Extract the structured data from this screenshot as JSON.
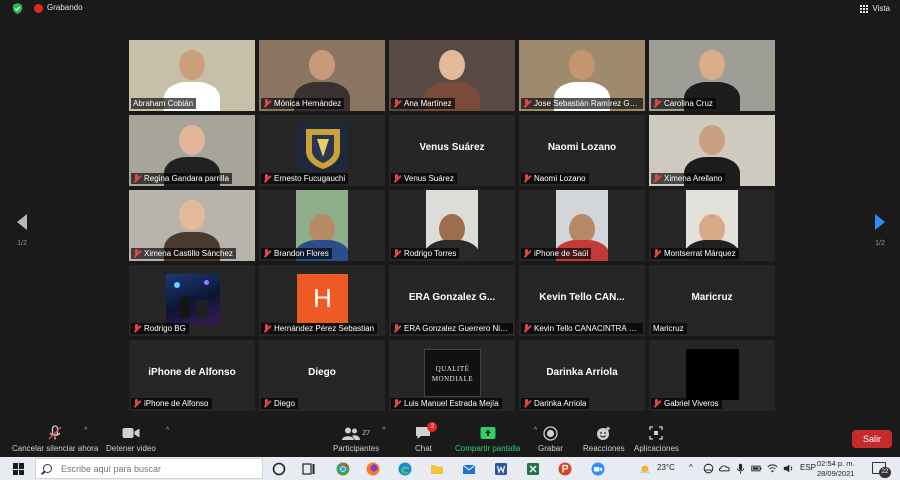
{
  "topbar": {
    "recording_label": "Grabando",
    "view_label": "Vista"
  },
  "pager": {
    "left_page": "1/2",
    "right_page": "1/2"
  },
  "grid": {
    "tiles": [
      {
        "name": "Abraham Cobián",
        "big": "",
        "muted": false,
        "active": true,
        "bg": "#c7c0a8",
        "skin": "#c9a07a",
        "shirt": "#ffffff"
      },
      {
        "name": "Mónica Hernández",
        "big": "",
        "muted": true,
        "bg": "#8a7560",
        "skin": "#c99a7a",
        "shirt": "#3a3030"
      },
      {
        "name": "Ana Martínez",
        "big": "",
        "muted": true,
        "bg": "#5a4a44",
        "skin": "#e3b99c",
        "shirt": "#7a4a3a"
      },
      {
        "name": "Jose Sebastián Ramírez Gaona",
        "big": "",
        "muted": true,
        "bg": "#a08a6e",
        "skin": "#c4956e",
        "shirt": "#ffffff"
      },
      {
        "name": "Carolina Cruz",
        "big": "",
        "muted": true,
        "bg": "#9e9e96",
        "skin": "#d9ad8c",
        "shirt": "#1d1d1d"
      },
      {
        "name": "Regina Gandara parrilla",
        "big": "",
        "muted": true,
        "bg": "#a7a49a",
        "skin": "#e0b598",
        "shirt": "#222222"
      },
      {
        "name": "Ernesto Fucugauchi",
        "big": "",
        "muted": true,
        "logo": "unam",
        "bg": "#262626"
      },
      {
        "name": "Venus Suárez",
        "big": "Venus Suárez",
        "muted": true
      },
      {
        "name": "Naomi Lozano",
        "big": "Naomi Lozano",
        "muted": true
      },
      {
        "name": "Ximena Arellano",
        "big": "",
        "muted": true,
        "bg": "#cfcac0",
        "skin": "#caa083",
        "shirt": "#1c1c1c"
      },
      {
        "name": "Ximena Castillo Sánchez",
        "big": "",
        "muted": true,
        "bg": "#b9b4ab",
        "skin": "#e3b99a",
        "shirt": "#4a3a2e"
      },
      {
        "name": "Brandon Flores",
        "big": "",
        "muted": true,
        "narrow": true,
        "bg": "#8fae8a",
        "skin": "#b98a66",
        "shirt": "#2a4e8a"
      },
      {
        "name": "Rodrigo Torres",
        "big": "",
        "muted": true,
        "narrow": true,
        "bg": "#dcdcd8",
        "skin": "#9c6e4e",
        "shirt": "#2a2a2a"
      },
      {
        "name": "iPhone de Saúl",
        "big": "",
        "muted": true,
        "narrow": true,
        "bg": "#d2d6da",
        "skin": "#b68866",
        "shirt": "#c23a3a"
      },
      {
        "name": "Montserrat Márquez",
        "big": "",
        "muted": true,
        "narrow": true,
        "bg": "#e2e0da",
        "skin": "#d8aa88",
        "shirt": "#202020"
      },
      {
        "name": "Rodrigo BG",
        "big": "",
        "muted": true,
        "stage": true
      },
      {
        "name": "Hernández Pérez Sebastian",
        "big": "",
        "muted": true,
        "letter": "H"
      },
      {
        "name": "ERA Gonzalez Guerrero Nicolas Saul",
        "big": "ERA Gonzalez G...",
        "muted": true
      },
      {
        "name": "Kevin Tello CANACINTRA Celaya",
        "big": "Kevin Tello CAN...",
        "muted": true
      },
      {
        "name": "Maricruz",
        "big": "Maricruz",
        "muted": false
      },
      {
        "name": "iPhone de Alfonso",
        "big": "iPhone de Alfonso",
        "muted": true
      },
      {
        "name": "Diego",
        "big": "Diego",
        "muted": true
      },
      {
        "name": "Luis Manuel Estrada Mejía",
        "big": "",
        "muted": true,
        "brand": "QUALITÉ MONDIALE"
      },
      {
        "name": "Darinka Arriola",
        "big": "Darinka Arriola",
        "muted": true
      },
      {
        "name": "Gabriel Viveros",
        "big": "",
        "muted": true,
        "black": true
      }
    ]
  },
  "toolbar": {
    "mute_label": "Cancelar silenciar ahora",
    "video_label": "Detener video",
    "participants_label": "Participantes",
    "participants_count": "27",
    "chat_label": "Chat",
    "chat_badge": "2",
    "share_label": "Compartir pantalla",
    "record_label": "Grabar",
    "reactions_label": "Reacciones",
    "apps_label": "Aplicaciones",
    "leave_label": "Salir"
  },
  "taskbar": {
    "search_placeholder": "Escribe aquí para buscar",
    "weather": "23°C",
    "language": "ESP",
    "time": "02:54 p. m.",
    "date": "28/09/2021",
    "notifications": "22"
  },
  "colors": {
    "active_border": "#b8d94a",
    "share_green": "#2fcf6a",
    "leave_red": "#c62a2a",
    "mute_red": "#e04848",
    "accent_blue": "#2d8cff"
  }
}
